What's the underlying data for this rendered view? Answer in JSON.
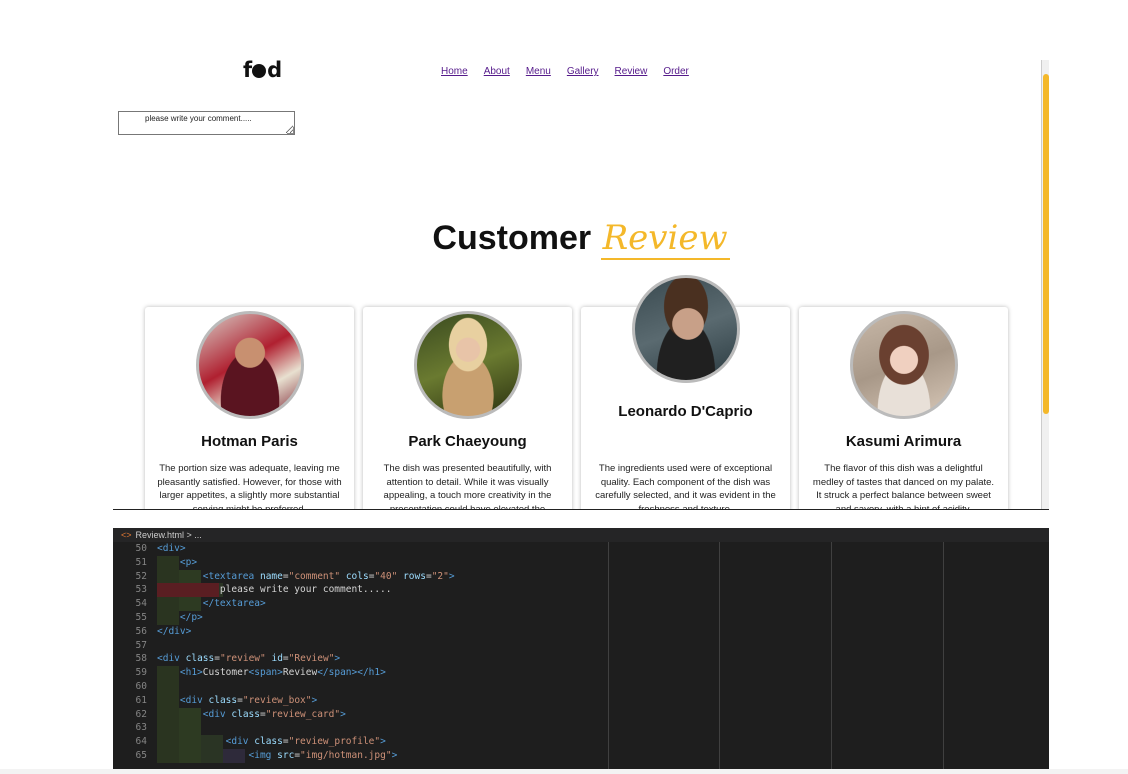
{
  "brand": {
    "logo_pre": "f",
    "logo_post": "d"
  },
  "nav": [
    {
      "label": "Home"
    },
    {
      "label": "About"
    },
    {
      "label": "Menu"
    },
    {
      "label": "Gallery"
    },
    {
      "label": "Review"
    },
    {
      "label": "Order"
    }
  ],
  "comment": {
    "value": "please write your comment....."
  },
  "review": {
    "title_main": "Customer",
    "title_highlight": "Review"
  },
  "cards": [
    {
      "name": "Hotman Paris",
      "text": "The portion size was adequate, leaving me pleasantly satisfied. However, for those with larger appetites, a slightly more substantial serving might be preferred."
    },
    {
      "name": "Park Chaeyoung",
      "text": "The dish was presented beautifully, with attention to detail. While it was visually appealing, a touch more creativity in the presentation could have elevated the experience."
    },
    {
      "name": "Leonardo D'Caprio",
      "text": "The ingredients used were of exceptional quality. Each component of the dish was carefully selected, and it was evident in the freshness and texture."
    },
    {
      "name": "Kasumi Arimura",
      "text": "The flavor of this dish was a delightful medley of tastes that danced on my palate. It struck a perfect balance between sweet and savory, with a hint of acidity."
    }
  ],
  "editor": {
    "file": "Review.html",
    "crumb_rest": "> ...",
    "lines": [
      {
        "n": "50",
        "html": "<span class=\"t\">&lt;div&gt;</span>"
      },
      {
        "n": "51",
        "html": "    <span class=\"t\">&lt;p&gt;</span>"
      },
      {
        "n": "52",
        "html": "        <span class=\"t\">&lt;textarea</span> <span class=\"a\">name</span>=<span class=\"s\">\"comment\"</span> <span class=\"a\">cols</span>=<span class=\"s\">\"40\"</span> <span class=\"a\">rows</span>=<span class=\"s\">\"2\"</span><span class=\"t\">&gt;</span>"
      },
      {
        "n": "53",
        "html": "           please write your comment....."
      },
      {
        "n": "54",
        "html": "        <span class=\"t\">&lt;/textarea&gt;</span>"
      },
      {
        "n": "55",
        "html": "    <span class=\"t\">&lt;/p&gt;</span>"
      },
      {
        "n": "56",
        "html": "<span class=\"t\">&lt;/div&gt;</span>"
      },
      {
        "n": "57",
        "html": ""
      },
      {
        "n": "58",
        "html": "<span class=\"t\">&lt;div</span> <span class=\"a\">class</span>=<span class=\"s\">\"review\"</span> <span class=\"a\">id</span>=<span class=\"s\">\"Review\"</span><span class=\"t\">&gt;</span>"
      },
      {
        "n": "59",
        "html": "    <span class=\"t\">&lt;h1&gt;</span>Customer<span class=\"t\">&lt;span&gt;</span>Review<span class=\"t\">&lt;/span&gt;&lt;/h1&gt;</span>"
      },
      {
        "n": "60",
        "html": ""
      },
      {
        "n": "61",
        "html": "    <span class=\"t\">&lt;div</span> <span class=\"a\">class</span>=<span class=\"s\">\"review_box\"</span><span class=\"t\">&gt;</span>"
      },
      {
        "n": "62",
        "html": "        <span class=\"t\">&lt;div</span> <span class=\"a\">class</span>=<span class=\"s\">\"review_card\"</span><span class=\"t\">&gt;</span>"
      },
      {
        "n": "63",
        "html": ""
      },
      {
        "n": "64",
        "html": "            <span class=\"t\">&lt;div</span> <span class=\"a\">class</span>=<span class=\"s\">\"review_profile\"</span><span class=\"t\">&gt;</span>"
      },
      {
        "n": "65",
        "html": "                <span class=\"t\">&lt;img</span> <span class=\"a\">src</span>=<span class=\"s\">\"img/hotman.jpg\"</span><span class=\"t\">&gt;</span>"
      }
    ]
  }
}
